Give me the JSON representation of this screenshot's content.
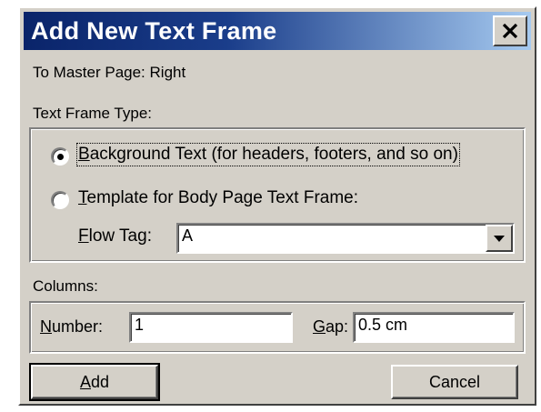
{
  "dialog": {
    "title": "Add New Text Frame",
    "close_icon": "close-icon"
  },
  "master_page": {
    "label": "To Master Page:",
    "value": "Right"
  },
  "frame_type": {
    "heading": "Text Frame Type:",
    "options": [
      {
        "accel": "B",
        "rest": "ackground Text (for headers, footers, and so on)",
        "selected": true
      },
      {
        "accel": "T",
        "rest": "emplate for Body Page Text Frame:",
        "selected": false
      }
    ],
    "flow_tag": {
      "accel": "F",
      "rest": "low Tag:",
      "value": "A",
      "dropdown_icon": "chevron-down-icon"
    }
  },
  "columns": {
    "heading": "Columns:",
    "number": {
      "accel": "N",
      "rest": "umber:",
      "value": "1"
    },
    "gap": {
      "accel": "G",
      "rest": "ap:",
      "value": "0.5 cm"
    }
  },
  "buttons": {
    "add": {
      "accel": "A",
      "rest": "dd"
    },
    "cancel": "Cancel"
  },
  "colors": {
    "title_bar": "#0a246a",
    "face": "#d4d0c8"
  }
}
